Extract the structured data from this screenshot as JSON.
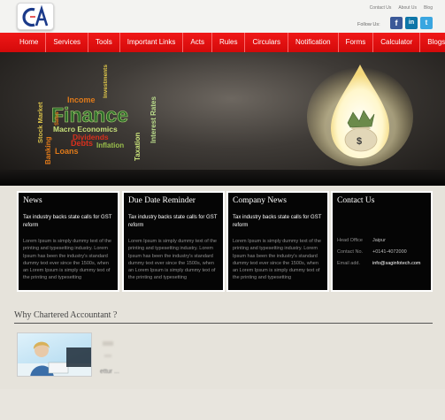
{
  "header": {
    "logo_text": "CA",
    "top_links": [
      "Contact Us",
      "About Us",
      "Blog"
    ],
    "follow_label": "Follow Us:",
    "social": [
      {
        "name": "facebook",
        "glyph": "f",
        "color": "#3b5998"
      },
      {
        "name": "linkedin",
        "glyph": "in",
        "color": "#0e76a8"
      },
      {
        "name": "twitter",
        "glyph": "t",
        "color": "#3aa6e0"
      }
    ]
  },
  "nav": {
    "items": [
      "Home",
      "Services",
      "Tools",
      "Important Links",
      "Acts",
      "Rules",
      "Circulars",
      "Notification",
      "Forms",
      "Calculator",
      "Blogs"
    ]
  },
  "banner": {
    "words": [
      "Finance",
      "Macro Economics",
      "Dividends",
      "Income",
      "Inflation",
      "Debts",
      "Loans",
      "Banking",
      "Stock Market",
      "Taxation",
      "Interest Rates",
      "Investments",
      "Sales"
    ],
    "bag_symbol": "$",
    "colors": {
      "accent_red": "#d8301d",
      "accent_orange": "#e07a1a",
      "accent_green": "#9abf4c",
      "finance_green": "#2b6b28"
    }
  },
  "boxes": [
    {
      "title": "News",
      "headline": "Tax industry backs state calls for GST reform",
      "body": "Lorem Ipsum is simply dummy text of the printing and typesetting industry. Lorem Ipsum has been the industry's standard dummy text ever since the 1500s, when an Lorem Ipsum is simply dummy text of the printing and typesetting"
    },
    {
      "title": "Due Date Reminder",
      "headline": "Tax industry backs state calls for GST reform",
      "body": "Lorem Ipsum is simply dummy text of the printing and typesetting industry. Lorem Ipsum has been the industry's standard dummy text ever since the 1500s, when an Lorem Ipsum is simply dummy text of the printing and typesetting"
    },
    {
      "title": "Company News",
      "headline": "Tax industry backs state calls for GST reform",
      "body": "Lorem Ipsum is simply dummy text of the printing and typesetting industry. Lorem Ipsum has been the industry's standard dummy text ever since the 1500s, when an Lorem Ipsum is simply dummy text of the printing and typesetting"
    }
  ],
  "contact": {
    "title": "Contact Us",
    "rows": [
      {
        "key": "Head Office",
        "value": "Jaipur"
      },
      {
        "key": "Contact No.",
        "value": "+0141-4072000"
      },
      {
        "key": "Email add.",
        "value": "info@saginfotech.com"
      }
    ]
  },
  "why": {
    "title": "Why Chartered Accountant ?",
    "snippet": "ettur ..."
  },
  "theme": {
    "nav_red": "#e51212",
    "page_bg": "#e6e3db",
    "box_bg": "#050505"
  }
}
